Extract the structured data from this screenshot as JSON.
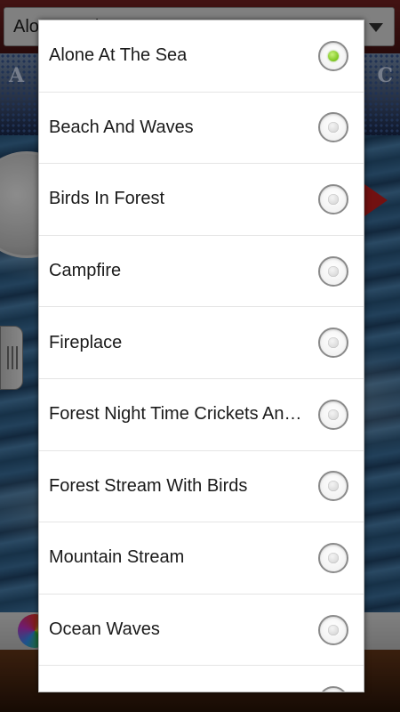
{
  "background": {
    "select_value": "Alone At The Sea",
    "banner_left": "A",
    "banner_right": "C"
  },
  "dialog": {
    "options": [
      {
        "label": "Alone At The Sea",
        "selected": true
      },
      {
        "label": "Beach And Waves",
        "selected": false
      },
      {
        "label": "Birds In Forest",
        "selected": false
      },
      {
        "label": "Campfire",
        "selected": false
      },
      {
        "label": "Fireplace",
        "selected": false
      },
      {
        "label": "Forest Night Time Crickets And Owls",
        "selected": false
      },
      {
        "label": "Forest Stream With Birds",
        "selected": false
      },
      {
        "label": "Mountain Stream",
        "selected": false
      },
      {
        "label": "Ocean Waves",
        "selected": false
      },
      {
        "label": "",
        "selected": false
      }
    ]
  },
  "colors": {
    "selected_radio": "#7cc51e",
    "dialog_background": "#ffffff"
  }
}
